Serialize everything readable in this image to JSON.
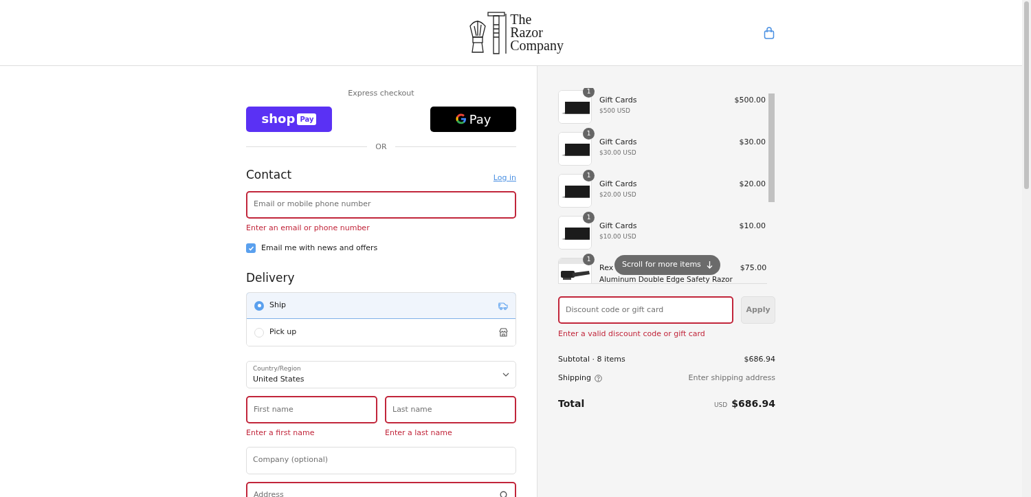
{
  "header": {
    "logo_lines": [
      "The",
      "Razor",
      "Company"
    ]
  },
  "express": {
    "label": "Express checkout",
    "buttons": [
      {
        "kind": "shoppay",
        "text": "shop",
        "badge": "Pay"
      },
      {
        "kind": "gpay",
        "text": "Pay"
      }
    ],
    "divider": "OR"
  },
  "contact": {
    "heading": "Contact",
    "login": "Log in",
    "field": {
      "placeholder": "Email or mobile phone number",
      "error": "Enter an email or phone number"
    },
    "newsletter": {
      "label": "Email me with news and offers",
      "checked": true
    }
  },
  "delivery": {
    "heading": "Delivery",
    "options": [
      {
        "label": "Ship",
        "kind": "ship",
        "selected": true
      },
      {
        "label": "Pick up",
        "kind": "pickup",
        "selected": false
      }
    ],
    "country": {
      "label": "Country/Region",
      "value": "United States"
    },
    "fields": [
      {
        "row": [
          {
            "placeholder": "First name",
            "error": "Enter a first name"
          },
          {
            "placeholder": "Last name",
            "error": "Enter a last name"
          }
        ]
      },
      {
        "row": [
          {
            "placeholder": "Company (optional)"
          }
        ]
      },
      {
        "row": [
          {
            "placeholder": "Address",
            "search": true,
            "invalid": true
          }
        ]
      }
    ]
  },
  "summary": {
    "items": [
      {
        "kind": "gift",
        "quantity": "1",
        "title": "Gift Cards",
        "variant": "$500 USD",
        "price": "$500.00"
      },
      {
        "kind": "gift",
        "quantity": "1",
        "title": "Gift Cards",
        "variant": "$30.00 USD",
        "price": "$30.00"
      },
      {
        "kind": "gift",
        "quantity": "1",
        "title": "Gift Cards",
        "variant": "$20.00 USD",
        "price": "$20.00"
      },
      {
        "kind": "gift",
        "quantity": "1",
        "title": "Gift Cards",
        "variant": "$10.00 USD",
        "price": "$10.00"
      },
      {
        "kind": "razor",
        "quantity": "1",
        "title": "Rex",
        "title_line2": "Aluminum Double Edge Safety Razor",
        "price": "$75.00"
      }
    ],
    "scroll_hint": "Scroll for more items",
    "discount": {
      "placeholder": "Discount code or gift card",
      "error": "Enter a valid discount code or gift card",
      "button": "Apply"
    },
    "subtotal": {
      "label": "Subtotal · 8 items",
      "value": "$686.94"
    },
    "shipping": {
      "label": "Shipping",
      "value": "Enter shipping address"
    },
    "total": {
      "label": "Total",
      "currency": "USD",
      "value": "$686.94"
    }
  }
}
